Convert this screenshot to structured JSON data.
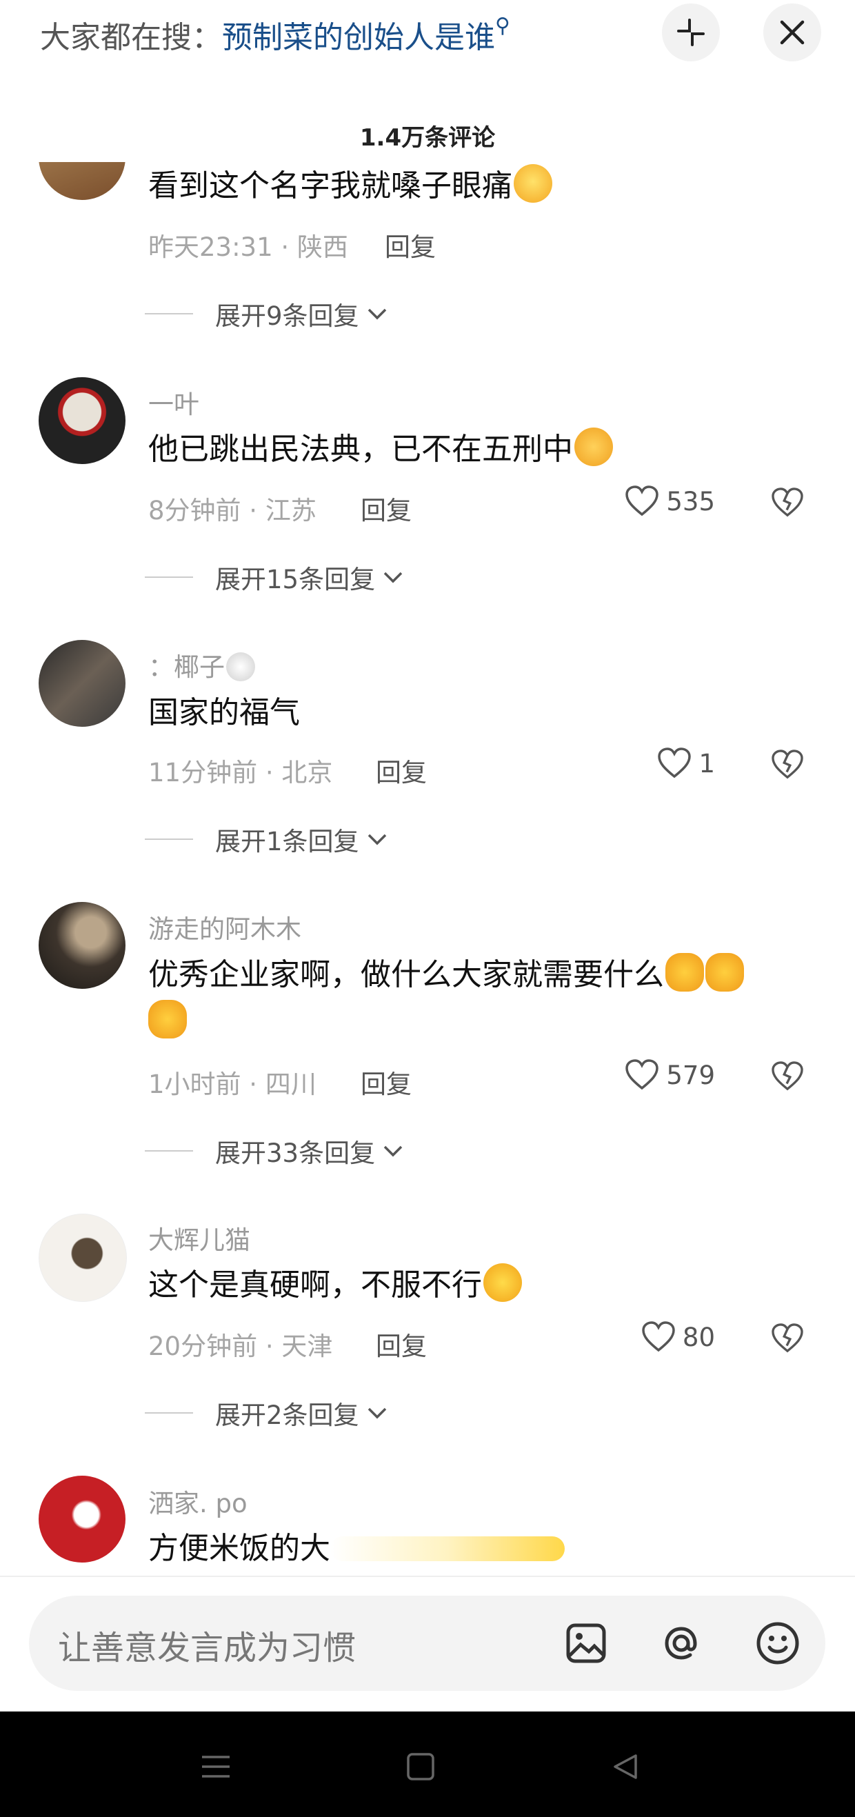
{
  "top": {
    "search_prefix": "大家都在搜：",
    "search_query": "预制菜的创始人是谁",
    "minimize_icon": "minimize-icon",
    "close_icon": "close-icon"
  },
  "comments_count": "1.4万条评论",
  "reply_label": "回复",
  "comments": [
    {
      "text": "看到这个名字我就嗓子眼痛",
      "meta": "昨天23:31 · 陕西",
      "expand": "展开9条回复"
    },
    {
      "user": "一叶",
      "text": "他已跳出民法典，已不在五刑中",
      "meta": "8分钟前 · 江苏",
      "likes": "535",
      "expand": "展开15条回复"
    },
    {
      "user": "：椰子",
      "text": "国家的福气",
      "meta": "11分钟前 · 北京",
      "likes": "1",
      "expand": "展开1条回复"
    },
    {
      "user": "游走的阿木木",
      "text_line1": "优秀企业家啊，做什么大家就需要什么",
      "meta": "1小时前 · 四川",
      "likes": "579",
      "expand": "展开33条回复"
    },
    {
      "user": "大辉儿猫",
      "text": "这个是真硬啊，不服不行",
      "meta": "20分钟前 · 天津",
      "likes": "80",
      "expand": "展开2条回复"
    },
    {
      "user": "洒家. po",
      "text": "方便米饭的大"
    }
  ],
  "input": {
    "placeholder": "让善意发言成为习惯",
    "icons": [
      "image-icon",
      "at-icon",
      "emoji-icon"
    ]
  },
  "colors": {
    "search_query": "#1a4f8a",
    "secondary_text": "#a5a5a5",
    "nav_background": "#000000"
  }
}
